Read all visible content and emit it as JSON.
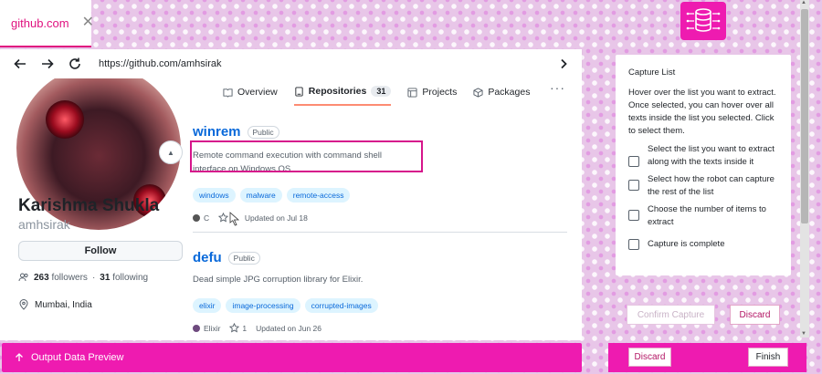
{
  "browser": {
    "tab_title": "github.com",
    "tab_close": "✕",
    "url": "https://github.com/amhsirak"
  },
  "profile": {
    "full_name": "Karishma Shukla",
    "login": "amhsirak",
    "follow_label": "Follow",
    "followers_count": "263",
    "followers_label": "followers",
    "separator": "·",
    "following_count": "31",
    "following_label": "following",
    "location": "Mumbai, India"
  },
  "nav": {
    "overview": "Overview",
    "repositories": "Repositories",
    "repositories_count": "31",
    "projects": "Projects",
    "packages": "Packages",
    "more": "···"
  },
  "repos": [
    {
      "name": "winrem",
      "visibility": "Public",
      "description": "Remote command execution with command shell interface on Windows OS",
      "topics": [
        "windows",
        "malware",
        "remote-access"
      ],
      "language": "C",
      "language_color": "#555555",
      "stars": "1",
      "updated": "Updated on Jul 18"
    },
    {
      "name": "defu",
      "visibility": "Public",
      "description": "Dead simple JPG corruption library for Elixir.",
      "topics": [
        "elixir",
        "image-processing",
        "corrupted-images"
      ],
      "language": "Elixir",
      "language_color": "#6e4a7e",
      "stars": "1",
      "updated": "Updated on Jun 26"
    }
  ],
  "output_preview": {
    "label": "Output Data Preview"
  },
  "capture": {
    "title": "Capture List",
    "description": "Hover over the list you want to extract. Once selected, you can hover over all texts inside the list you selected. Click to select them.",
    "steps": [
      "Select the list you want to extract along with the texts inside it",
      "Select how the robot can capture the rest of the list",
      "Choose the number of items to extract",
      "Capture is complete"
    ],
    "confirm_label": "Confirm Capture",
    "discard_label": "Discard"
  },
  "actions": {
    "discard_label": "Discard",
    "finish_label": "Finish"
  },
  "colors": {
    "accent": "#ee1bb0",
    "link": "#0969da",
    "highlight_border": "#d6158b"
  }
}
